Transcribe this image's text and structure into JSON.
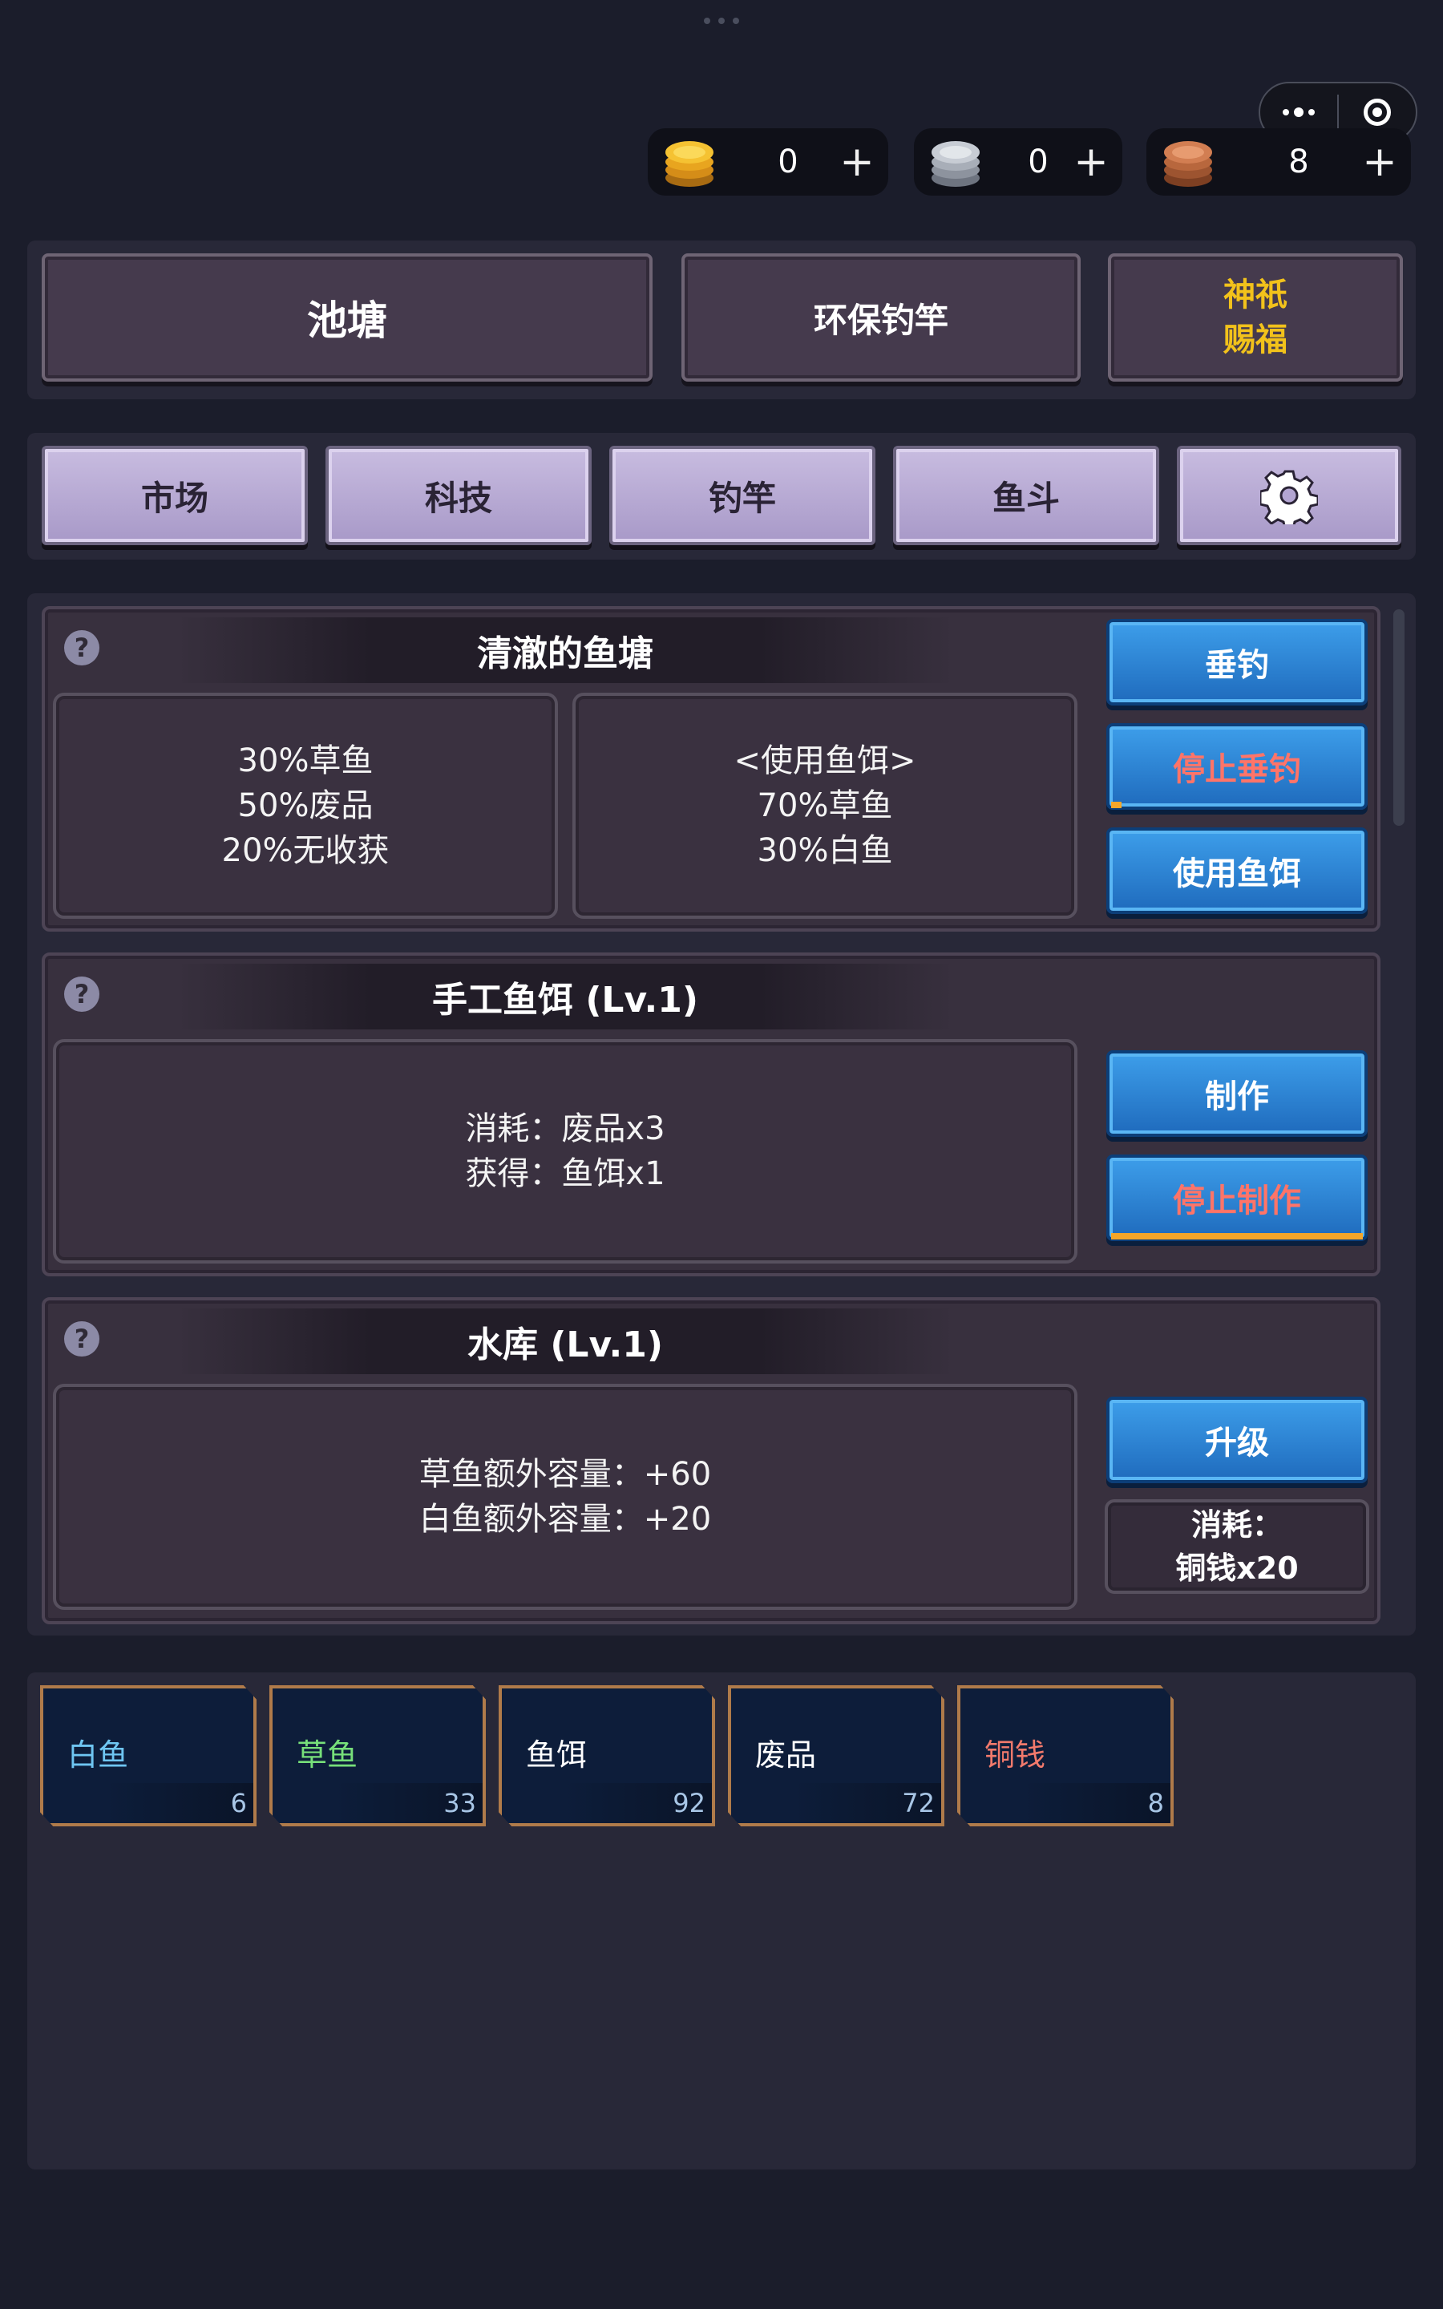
{
  "currencies": [
    {
      "name": "gold-coin",
      "amount": "0",
      "plus": "+",
      "color": "#f1b52a"
    },
    {
      "name": "silver-coin",
      "amount": "0",
      "plus": "+",
      "color": "#b9c0cc"
    },
    {
      "name": "copper-coin",
      "amount": "8",
      "plus": "+",
      "color": "#c9744a"
    }
  ],
  "header_tabs": {
    "pond": "池塘",
    "eco_rod": "环保钓竿",
    "blessing_line1": "神祇",
    "blessing_line2": "赐福"
  },
  "nav_tabs": [
    "市场",
    "科技",
    "钓竿",
    "鱼斗"
  ],
  "settings_icon": "gear-icon",
  "pond_card": {
    "help": "?",
    "title": "清澈的鱼塘",
    "left_lines": [
      "30%草鱼",
      "50%废品",
      "20%无收获"
    ],
    "right_lines": [
      "<使用鱼饵>",
      "70%草鱼",
      "30%白鱼"
    ],
    "buttons": [
      "垂钓",
      "停止垂钓",
      "使用鱼饵"
    ],
    "progress": 0.04
  },
  "bait_card": {
    "help": "?",
    "title": "手工鱼饵 (Lv.1)",
    "lines": [
      "消耗：废品x3",
      "获得：鱼饵x1"
    ],
    "buttons": [
      "制作",
      "停止制作"
    ],
    "progress": 1.0
  },
  "reservoir_card": {
    "help": "?",
    "title": "水库 (Lv.1)",
    "lines": [
      "草鱼额外容量：+60",
      "白鱼额外容量：+20"
    ],
    "button": "升级",
    "cost_lines": [
      "消耗：",
      "铜钱x20"
    ]
  },
  "inventory": [
    {
      "name": "白鱼",
      "count": "6",
      "color": "#6fc6f2"
    },
    {
      "name": "草鱼",
      "count": "33",
      "color": "#77e07a"
    },
    {
      "name": "鱼饵",
      "count": "92",
      "color": "#ffffff"
    },
    {
      "name": "废品",
      "count": "72",
      "color": "#ffffff"
    },
    {
      "name": "铜钱",
      "count": "8",
      "color": "#f27a6c"
    }
  ],
  "colors": {
    "accent_gold": "#f2c21b",
    "stop_red": "#ff7468",
    "progress": "#f4a62a"
  }
}
